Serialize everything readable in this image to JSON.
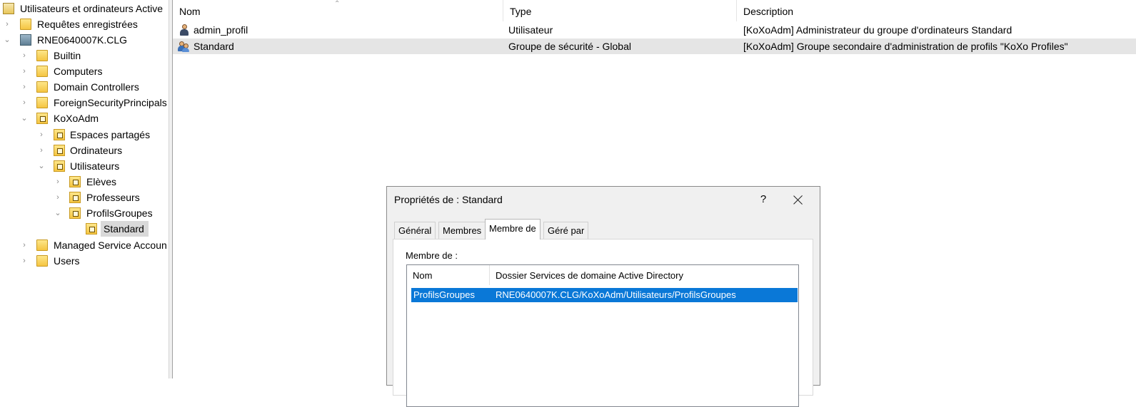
{
  "tree": {
    "root_label": "Utilisateurs et ordinateurs Active",
    "items": [
      {
        "label": "Requêtes enregistrées"
      },
      {
        "label": "RNE0640007K.CLG"
      },
      {
        "label": "Builtin"
      },
      {
        "label": "Computers"
      },
      {
        "label": "Domain Controllers"
      },
      {
        "label": "ForeignSecurityPrincipals"
      },
      {
        "label": "KoXoAdm"
      },
      {
        "label": "Espaces partagés"
      },
      {
        "label": "Ordinateurs"
      },
      {
        "label": "Utilisateurs"
      },
      {
        "label": "Elèves"
      },
      {
        "label": "Professeurs"
      },
      {
        "label": "ProfilsGroupes"
      },
      {
        "label": "Standard"
      },
      {
        "label": "Managed Service Accoun"
      },
      {
        "label": "Users"
      }
    ]
  },
  "list": {
    "columns": [
      "Nom",
      "Type",
      "Description"
    ],
    "rows": [
      {
        "name": "admin_profil",
        "type": "Utilisateur",
        "description": "[KoXoAdm] Administrateur du groupe d'ordinateurs Standard"
      },
      {
        "name": "Standard",
        "type": "Groupe de sécurité - Global",
        "description": "[KoXoAdm] Groupe secondaire d'administration de profils \"KoXo Profiles\""
      }
    ]
  },
  "dialog": {
    "title": "Propriétés de : Standard",
    "help": "?",
    "tabs": [
      "Général",
      "Membres",
      "Membre de",
      "Géré par"
    ],
    "active_tab": "Membre de",
    "member_of_label": "Membre de :",
    "columns": [
      "Nom",
      "Dossier Services de domaine Active Directory"
    ],
    "rows": [
      {
        "name": "ProfilsGroupes",
        "folder": "RNE0640007K.CLG/KoXoAdm/Utilisateurs/ProfilsGroupes"
      }
    ]
  }
}
